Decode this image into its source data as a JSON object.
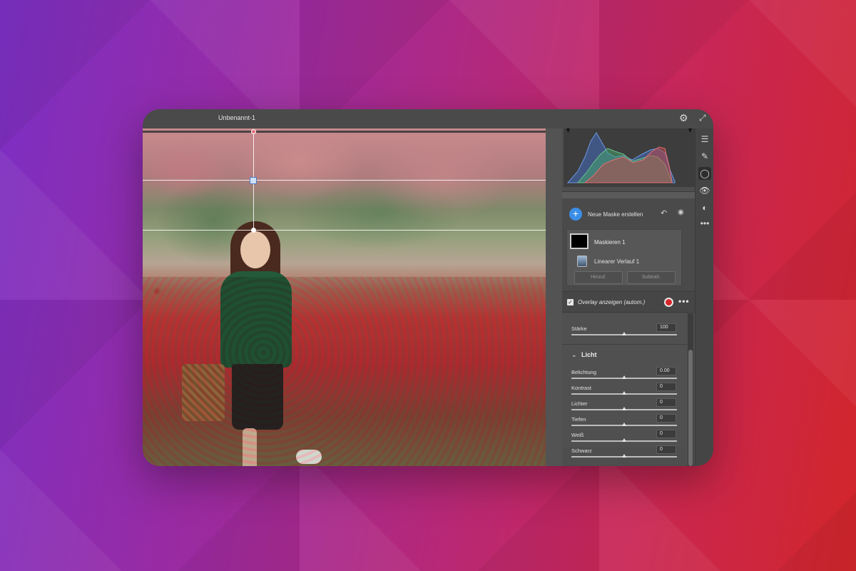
{
  "window": {
    "title": "Unbenannt-1"
  },
  "icons": {
    "settings": "gear-icon",
    "expand": "expand-icon"
  },
  "masks": {
    "new_mask_label": "Neue Maske erstellen",
    "items": [
      {
        "label": "Maskieren 1"
      },
      {
        "label": "Linearer Verlauf 1"
      }
    ],
    "add_label": "Hinzuf.",
    "subtract_label": "Subtrah."
  },
  "overlay": {
    "label": "Overlay anzeigen (autom.)",
    "checked": true,
    "color": "#d8262a"
  },
  "adjustments": {
    "strength": {
      "label": "Stärke",
      "value": "100"
    },
    "section_title": "Licht",
    "sliders": [
      {
        "label": "Belichtung",
        "value": "0.00"
      },
      {
        "label": "Kontrast",
        "value": "0"
      },
      {
        "label": "Lichter",
        "value": "0"
      },
      {
        "label": "Tiefen",
        "value": "0"
      },
      {
        "label": "Weiß",
        "value": "0"
      },
      {
        "label": "Schwarz",
        "value": "0"
      }
    ]
  },
  "accent_color": "#3b8ee8"
}
